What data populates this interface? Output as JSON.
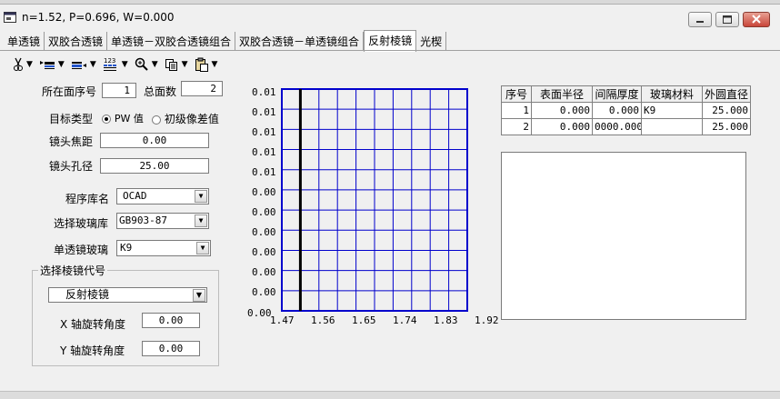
{
  "window": {
    "title": "n=1.52,   P=0.696,   W=0.000"
  },
  "tabs": [
    "单透镜",
    "双胶合透镜",
    "单透镜－双胶合透镜组合",
    "双胶合透镜－单透镜组合",
    "反射棱镜",
    "光楔"
  ],
  "active_tab": "反射棱镜",
  "toolbar": {
    "icons": [
      "cut-icon",
      "insert-row-icon",
      "delete-row-icon",
      "sort-icon",
      "zoom-icon",
      "copy-icon",
      "paste-icon"
    ]
  },
  "form": {
    "surface_index_label": "所在面序号",
    "surface_index_value": "1",
    "total_surfaces_label": "总面数",
    "total_surfaces_value": "2",
    "target_type_label": "目标类型",
    "target_option_pw": "PW 值",
    "target_option_aberration": "初级像差值",
    "focal_label": "镜头焦距",
    "focal_value": "0.00",
    "aperture_label": "镜头孔径",
    "aperture_value": "25.00",
    "library_label": "程序库名",
    "library_value": "OCAD",
    "glass_lib_label": "选择玻璃库",
    "glass_lib_value": "GB903-87",
    "glass_label": "单透镜玻璃",
    "glass_value": "K9"
  },
  "prism_group": {
    "title": "选择棱镜代号",
    "prism_value": "反射棱镜",
    "x_label": "X 轴旋转角度",
    "x_value": "0.00",
    "y_label": "Y 轴旋转角度",
    "y_value": "0.00"
  },
  "plot": {
    "y_ticks": [
      "0.01",
      "0.01",
      "0.01",
      "0.01",
      "0.01",
      "0.00",
      "0.00",
      "0.00",
      "0.00",
      "0.00",
      "0.00",
      "0.00"
    ],
    "x_ticks": [
      "1.47",
      "1.56",
      "1.65",
      "1.74",
      "1.83",
      "1.92"
    ],
    "grid_color": "#0000cc",
    "marker_color": "#000000"
  },
  "table": {
    "headers": [
      "序号",
      "表面半径",
      "间隔厚度",
      "玻璃材料",
      "外圆直径"
    ],
    "rows": [
      [
        "1",
        "0.000",
        "0.000",
        "K9",
        "25.000"
      ],
      [
        "2",
        "0.000",
        "0000.000",
        "",
        "25.000"
      ]
    ]
  }
}
